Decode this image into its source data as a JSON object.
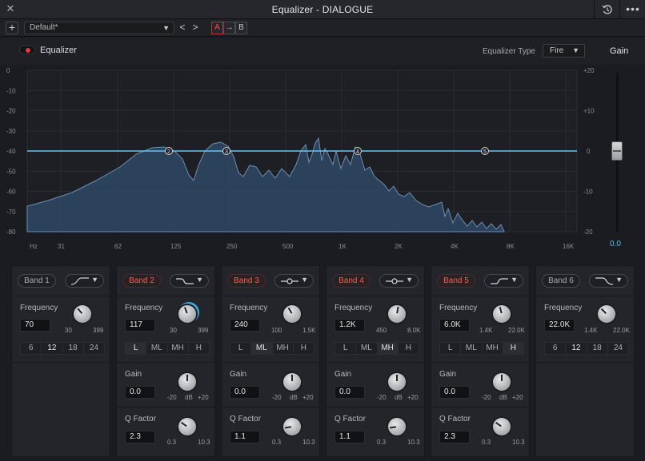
{
  "window": {
    "title": "Equalizer - DIALOGUE"
  },
  "toolbar": {
    "add_label": "+",
    "preset_value": "Default*",
    "prev_label": "<",
    "next_label": ">",
    "a_label": "A",
    "copy_label": "→",
    "b_label": "B"
  },
  "header": {
    "eq_label": "Equalizer",
    "eq_type_label": "Equalizer Type",
    "eq_type_value": "Fire",
    "gain_label": "Gain"
  },
  "graph": {
    "y_left_ticks": [
      "0",
      "-10",
      "-20",
      "-30",
      "-40",
      "-50",
      "-60",
      "-70",
      "-80"
    ],
    "y_right_ticks": [
      "+20",
      "+10",
      "0",
      "-10",
      "-20"
    ],
    "x_ticks": [
      "Hz",
      "31",
      "62",
      "125",
      "250",
      "500",
      "1K",
      "2K",
      "4K",
      "8K",
      "16K"
    ],
    "markers": [
      "2",
      "3",
      "4",
      "5"
    ]
  },
  "gain": {
    "value": "0.0",
    "level_db": 0
  },
  "bands": [
    {
      "label": "Band 1",
      "active": false,
      "shape": "high-pass",
      "frequency_label": "Frequency",
      "frequency": "70",
      "freq_min": "30",
      "freq_max": "399",
      "slopes": [
        "6",
        "12",
        "18",
        "24"
      ],
      "selected_slope": "12"
    },
    {
      "label": "Band 2",
      "active": true,
      "shape": "low-shelf",
      "frequency_label": "Frequency",
      "frequency": "117",
      "freq_min": "30",
      "freq_max": "399",
      "types": [
        "L",
        "ML",
        "MH",
        "H"
      ],
      "selected_type": "L",
      "gain_label": "Gain",
      "gain": "0.0",
      "gain_min": "-20",
      "gain_unit": "dB",
      "gain_max": "+20",
      "q_label": "Q Factor",
      "q": "2.3",
      "q_min": "0.3",
      "q_max": "10.3"
    },
    {
      "label": "Band 3",
      "active": true,
      "shape": "bell",
      "frequency_label": "Frequency",
      "frequency": "240",
      "freq_min": "100",
      "freq_max": "1.5K",
      "types": [
        "L",
        "ML",
        "MH",
        "H"
      ],
      "selected_type": "ML",
      "gain_label": "Gain",
      "gain": "0.0",
      "gain_min": "-20",
      "gain_unit": "dB",
      "gain_max": "+20",
      "q_label": "Q Factor",
      "q": "1.1",
      "q_min": "0.3",
      "q_max": "10.3"
    },
    {
      "label": "Band 4",
      "active": true,
      "shape": "bell",
      "frequency_label": "Frequency",
      "frequency": "1.2K",
      "freq_min": "450",
      "freq_max": "8.0K",
      "types": [
        "L",
        "ML",
        "MH",
        "H"
      ],
      "selected_type": "MH",
      "gain_label": "Gain",
      "gain": "0.0",
      "gain_min": "-20",
      "gain_unit": "dB",
      "gain_max": "+20",
      "q_label": "Q Factor",
      "q": "1.1",
      "q_min": "0.3",
      "q_max": "10.3"
    },
    {
      "label": "Band 5",
      "active": true,
      "shape": "high-shelf",
      "frequency_label": "Frequency",
      "frequency": "6.0K",
      "freq_min": "1.4K",
      "freq_max": "22.0K",
      "types": [
        "L",
        "ML",
        "MH",
        "H"
      ],
      "selected_type": "H",
      "gain_label": "Gain",
      "gain": "0.0",
      "gain_min": "-20",
      "gain_unit": "dB",
      "gain_max": "+20",
      "q_label": "Q Factor",
      "q": "2.3",
      "q_min": "0.3",
      "q_max": "10.3"
    },
    {
      "label": "Band 6",
      "active": false,
      "shape": "low-pass",
      "frequency_label": "Frequency",
      "frequency": "22.0K",
      "freq_min": "1.4K",
      "freq_max": "22.0K",
      "slopes": [
        "6",
        "12",
        "18",
        "24"
      ],
      "selected_slope": "12"
    }
  ]
}
